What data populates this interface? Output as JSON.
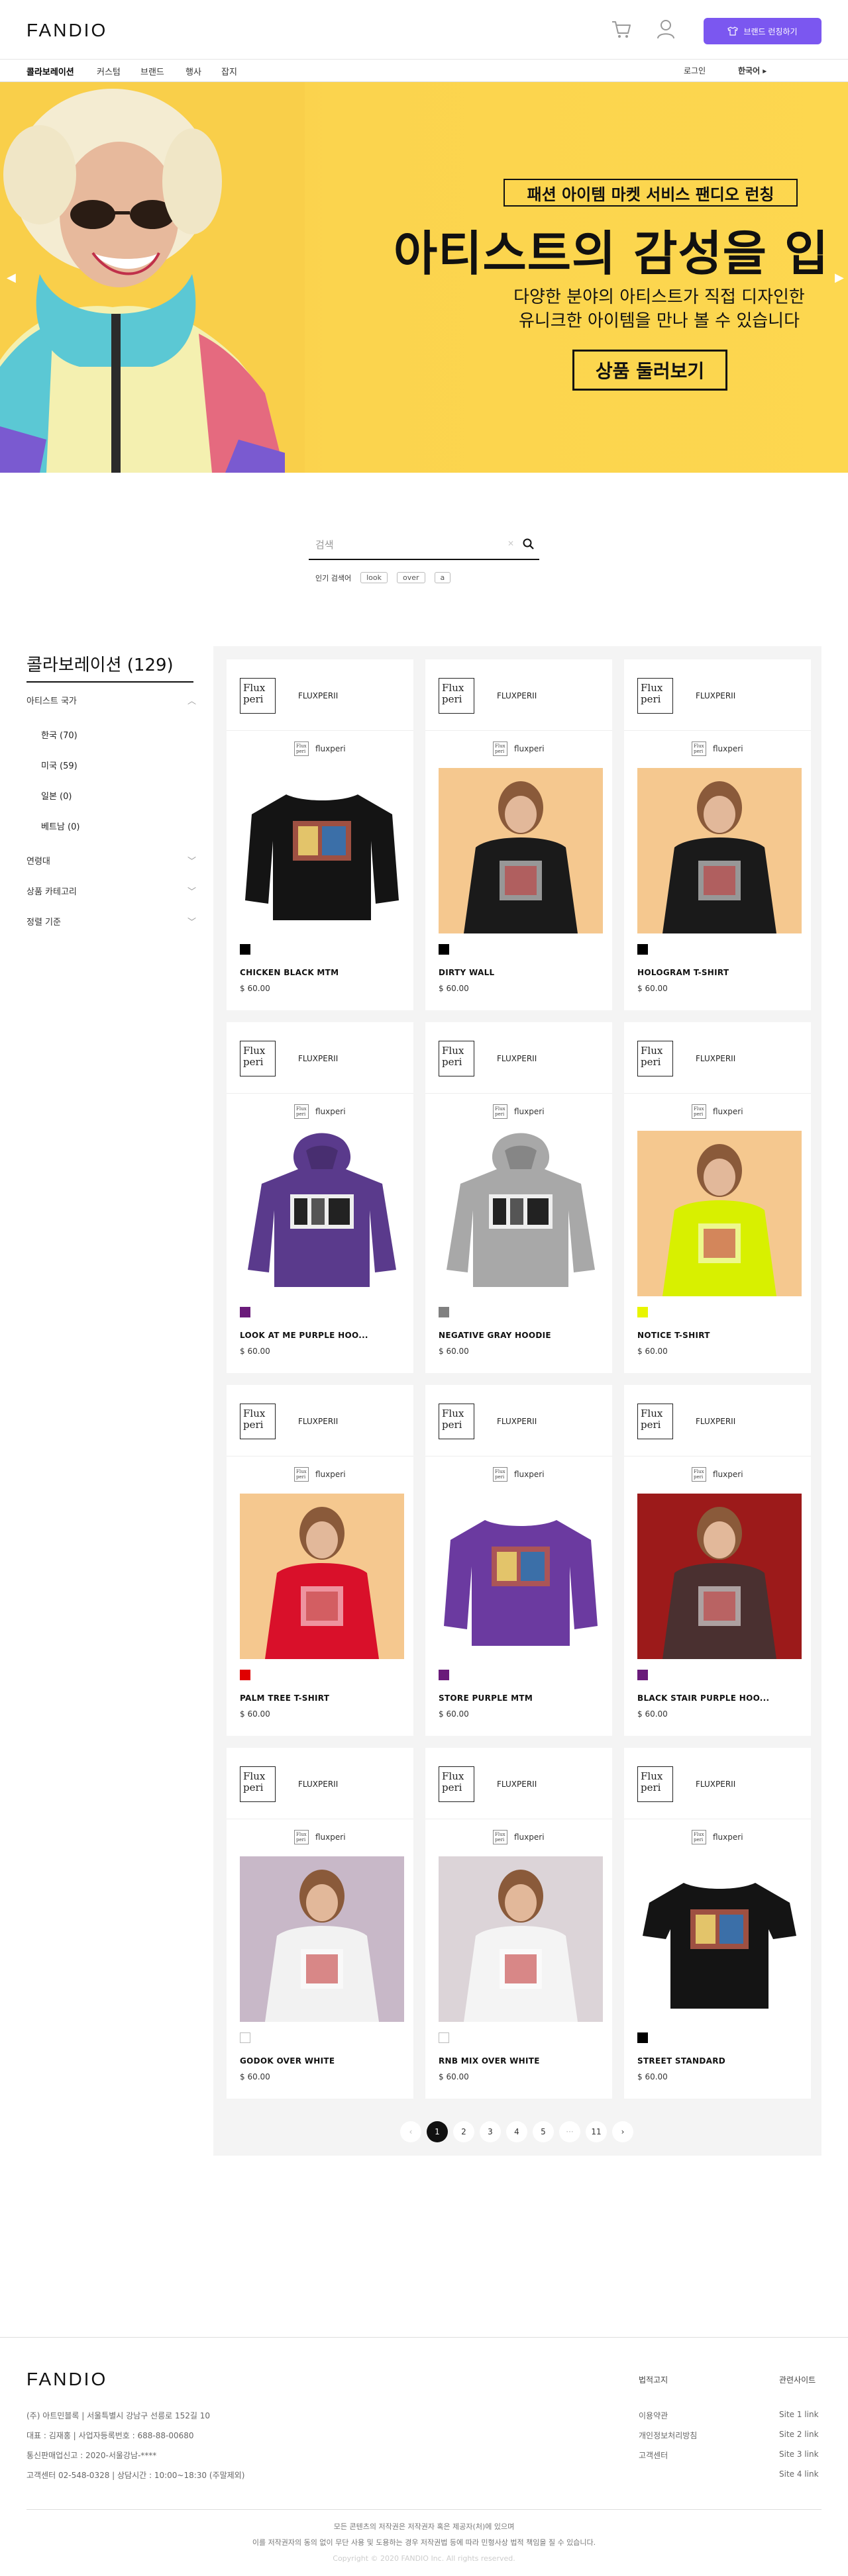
{
  "header": {
    "logo": "FANDIO",
    "brand_button": "브랜드 런칭하기",
    "icons": {
      "cart": "cart-icon",
      "user": "user-icon",
      "shirt": "shirt-icon"
    }
  },
  "nav": {
    "items": [
      "콜라보레이션",
      "커스텀",
      "브랜드",
      "행사",
      "잡지"
    ],
    "login": "로그인",
    "language": "한국어 ▸"
  },
  "hero": {
    "tag": "패션 아이템 마켓 서비스 팬디오 런칭",
    "title": "아티스트의 감성을 입",
    "subtitle_line1": "다양한 분야의 아티스트가 직접 디자인한",
    "subtitle_line2": "유니크한 아이템을 만나 볼 수 있습니다",
    "cta": "상품 둘러보기",
    "colors": {
      "background": "#fbd34d"
    }
  },
  "search": {
    "placeholder": "검색",
    "popular_label": "인기 검색어",
    "keywords": [
      "look",
      "over",
      "a"
    ]
  },
  "sidebar": {
    "title": "콜라보레이션 (129)",
    "groups": [
      {
        "label": "아티스트 국가"
      },
      {
        "label": "연령대"
      },
      {
        "label": "상품 카테고리"
      },
      {
        "label": "정렬 기준"
      }
    ],
    "countries": [
      "한국 (70)",
      "미국 (59)",
      "일본 (0)",
      "베트남 (0)"
    ]
  },
  "products": [
    {
      "brand": "FLUXPERII",
      "mini": "fluxperi",
      "name": "CHICKEN BLACK MTM",
      "price": "$ 60.00",
      "swatch": "#000000",
      "bg": "#ffffff",
      "garment": "#141414",
      "kind": "sweat"
    },
    {
      "brand": "FLUXPERII",
      "mini": "fluxperi",
      "name": "DIRTY WALL",
      "price": "$ 60.00",
      "swatch": "#000000",
      "bg": "#f5c88f",
      "garment": "#1a1a1a",
      "kind": "model"
    },
    {
      "brand": "FLUXPERII",
      "mini": "fluxperi",
      "name": "HOLOGRAM T-SHIRT",
      "price": "$ 60.00",
      "swatch": "#000000",
      "bg": "#f5c88f",
      "garment": "#1a1a1a",
      "kind": "model"
    },
    {
      "brand": "FLUXPERII",
      "mini": "fluxperi",
      "name": "LOOK AT ME PURPLE HOO...",
      "price": "$ 60.00",
      "swatch": "#6a1b7a",
      "bg": "#ffffff",
      "garment": "#5a3a8c",
      "kind": "hoodie"
    },
    {
      "brand": "FLUXPERII",
      "mini": "fluxperi",
      "name": "NEGATIVE GRAY HOODIE",
      "price": "$ 60.00",
      "swatch": "#808080",
      "bg": "#ffffff",
      "garment": "#a8a8a8",
      "kind": "hoodie"
    },
    {
      "brand": "FLUXPERII",
      "mini": "fluxperi",
      "name": "NOTICE T-SHIRT",
      "price": "$ 60.00",
      "swatch": "#e8f500",
      "bg": "#f5c88f",
      "garment": "#d8f000",
      "kind": "model"
    },
    {
      "brand": "FLUXPERII",
      "mini": "fluxperi",
      "name": "PALM TREE T-SHIRT",
      "price": "$ 60.00",
      "swatch": "#e00000",
      "bg": "#f5c88f",
      "garment": "#d9102a",
      "kind": "model"
    },
    {
      "brand": "FLUXPERII",
      "mini": "fluxperi",
      "name": "STORE PURPLE MTM",
      "price": "$ 60.00",
      "swatch": "#6a1b7a",
      "bg": "#ffffff",
      "garment": "#6b3aa0",
      "kind": "sweat"
    },
    {
      "brand": "FLUXPERII",
      "mini": "fluxperi",
      "name": "BLACK STAIR PURPLE HOO...",
      "price": "$ 60.00",
      "swatch": "#6a1b7a",
      "bg": "#9c1a1a",
      "garment": "#4a3030",
      "kind": "model"
    },
    {
      "brand": "FLUXPERII",
      "mini": "fluxperi",
      "name": "GODOK OVER WHITE",
      "price": "$ 60.00",
      "swatch": "#ffffff",
      "bg": "#c8b8c8",
      "garment": "#f2f2f2",
      "kind": "model"
    },
    {
      "brand": "FLUXPERII",
      "mini": "fluxperi",
      "name": "RNB MIX OVER WHITE",
      "price": "$ 60.00",
      "swatch": "#ffffff",
      "bg": "#dcd4d8",
      "garment": "#f4f4f4",
      "kind": "model"
    },
    {
      "brand": "FLUXPERII",
      "mini": "fluxperi",
      "name": "STREET STANDARD",
      "price": "$ 60.00",
      "swatch": "#000000",
      "bg": "#ffffff",
      "garment": "#141414",
      "kind": "tee"
    }
  ],
  "brand_logo_text": "Flux peri",
  "pagination": {
    "prev": "‹",
    "pages": [
      "1",
      "2",
      "3",
      "4",
      "5"
    ],
    "ellipsis": "···",
    "last": "11",
    "next": "›",
    "current": "1"
  },
  "footer": {
    "logo": "FANDIO",
    "info": [
      "(주) 아트민블록 | 서울특별시 강남구 선릉로 152길 10",
      "대표 : 김재홍 | 사업자등록번호 : 688-88-00680",
      "통신판매업신고 : 2020-서울강남-****",
      "고객센터 02-548-0328 | 상담시간 : 10:00~18:30 (주말제외)"
    ],
    "legal_title": "법적고지",
    "legal_items": [
      "이용약관",
      "개인정보처리방침",
      "고객센터"
    ],
    "related_title": "관련사이트",
    "related_items": [
      "Site 1 link",
      "Site 2 link",
      "Site 3 link",
      "Site 4 link"
    ],
    "notice_line1": "모든 콘텐츠의 저작권은 저작권자 혹은 제공자(처)에 있으며",
    "notice_line2": "이를 저작권자의 동의 없이 무단 사용 및 도용하는 경우 저작권법 등에 따라 민형사상 법적 책임을 질 수 있습니다.",
    "copyright": "Copyright © 2020 FANDIO Inc. All rights reserved."
  }
}
